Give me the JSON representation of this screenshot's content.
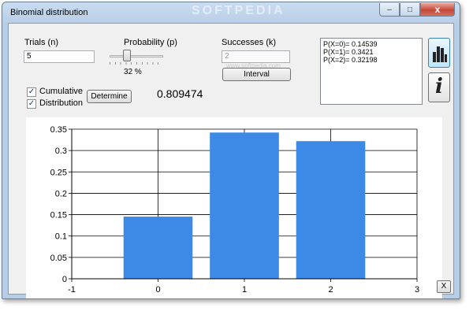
{
  "window": {
    "title": "Binomial distribution",
    "watermark": "SOFTPEDIA",
    "controls": {
      "minimize": "–",
      "maximize": "□",
      "close": "x"
    }
  },
  "inputs": {
    "trials_label": "Trials (n)",
    "trials_value": "5",
    "probability_label": "Probability (p)",
    "probability_value": 0.32,
    "probability_text": "32 %",
    "successes_label": "Successes (k)",
    "successes_value": "2",
    "successes_watermark": "www.softpedia.com",
    "interval_label": "Interval",
    "cumulative_label": "Cumulative",
    "cumulative_checked": true,
    "distribution_label": "Distribution",
    "distribution_checked": true,
    "determine_label": "Determine"
  },
  "result": {
    "value": "0.809474"
  },
  "probabilities": [
    "P(X=0)= 0.14539",
    "P(X=1)= 0.3421",
    "P(X=2)= 0.32198"
  ],
  "side_buttons": {
    "chart_icon": "bar-chart-icon",
    "info_icon": "info-icon",
    "info_glyph": "i"
  },
  "close_chart_label": "X",
  "colors": {
    "bar": "#3c8ae6",
    "grid": "#000000"
  },
  "chart_data": {
    "type": "bar",
    "x": [
      0,
      1,
      2
    ],
    "values": [
      0.14539,
      0.3421,
      0.32198
    ],
    "xlim": [
      -1,
      3
    ],
    "ylim": [
      0,
      0.35
    ],
    "xticks": [
      "-1",
      "0",
      "1",
      "2",
      "3"
    ],
    "yticks": [
      "0",
      "0.05",
      "0.1",
      "0.15",
      "0.2",
      "0.25",
      "0.3",
      "0.35"
    ],
    "grid": true
  }
}
